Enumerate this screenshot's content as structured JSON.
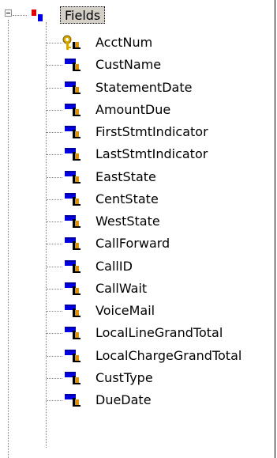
{
  "tree": {
    "root": {
      "label": "Fields",
      "expanded": true,
      "icon": "table-fields-icon"
    },
    "items": [
      {
        "label": "AcctNum",
        "icon": "key-field-icon"
      },
      {
        "label": "CustName",
        "icon": "field-icon"
      },
      {
        "label": "StatementDate",
        "icon": "field-icon"
      },
      {
        "label": "AmountDue",
        "icon": "field-icon"
      },
      {
        "label": "FirstStmtIndicator",
        "icon": "field-icon"
      },
      {
        "label": "LastStmtIndicator",
        "icon": "field-icon"
      },
      {
        "label": "EastState",
        "icon": "field-icon"
      },
      {
        "label": "CentState",
        "icon": "field-icon"
      },
      {
        "label": "WestState",
        "icon": "field-icon"
      },
      {
        "label": "CallForward",
        "icon": "field-icon"
      },
      {
        "label": "CallID",
        "icon": "field-icon"
      },
      {
        "label": "CallWait",
        "icon": "field-icon"
      },
      {
        "label": "VoiceMail",
        "icon": "field-icon"
      },
      {
        "label": "LocalLineGrandTotal",
        "icon": "field-icon"
      },
      {
        "label": "LocalChargeGrandTotal",
        "icon": "field-icon"
      },
      {
        "label": "CustType",
        "icon": "field-icon"
      },
      {
        "label": "DueDate",
        "icon": "field-icon"
      }
    ]
  },
  "colors": {
    "selection_bg": "#d4d0c8",
    "connector": "#808080",
    "field_blue": "#0000e0",
    "field_orange": "#e09000",
    "key_gold": "#d4a800"
  }
}
